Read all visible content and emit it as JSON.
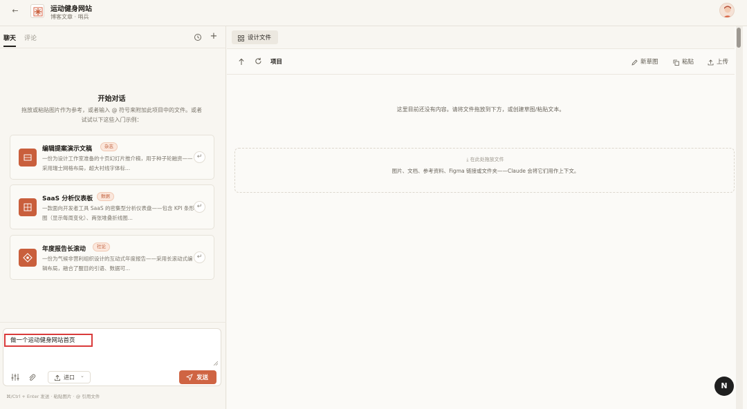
{
  "header": {
    "back_label": "←",
    "title": "运动健身网站",
    "subtitle": "博客文章 · 哨兵"
  },
  "left": {
    "tabs": [
      {
        "label": "聊天"
      },
      {
        "label": "评论"
      }
    ],
    "start": {
      "title": "开始对话",
      "description": "拖放或粘贴图片作为参考，或者输入 @ 符号来附加此项目中的文件。或者试试以下这些入门示例："
    },
    "cards": [
      {
        "title": "编辑提案演示文稿",
        "tag": "杂志",
        "desc": "一份为设计工作室准备的十页幻灯片推介稿，用于种子轮融资——采用瑞士网格布局，超大衬线字体标...",
        "enter": "↵"
      },
      {
        "title": "SaaS 分析仪表板",
        "tag": "数据",
        "desc": "一款面向开发者工具 SaaS 的密集型分析仪表盘——包含 KPI 条形图（显示每周变化）、两张堆叠折线图...",
        "enter": "↵"
      },
      {
        "title": "年度报告长滚动",
        "tag": "社论",
        "desc": "一份为气候非营利组织设计的互动式年度报告——采用长滚动式编辑布局，融合了醒目的引语、数据可...",
        "enter": "↵"
      }
    ],
    "composer": {
      "input_value": "做一个运动健身网站首页",
      "import_label": "进口",
      "import_chevron": "⌄",
      "send_label": "发送",
      "hint": "⌘/Ctrl + Enter 发送 · 粘贴图片 · @ 引用文件"
    }
  },
  "right": {
    "file_tab_label": "设计文件",
    "toolbar": {
      "project_label": "项目",
      "new_sketch_label": "新草图",
      "paste_label": "粘贴",
      "upload_label": "上传"
    },
    "empty_message": "这里目前还没有内容。请将文件拖放到下方，或创建草图/粘贴文本。",
    "dropzone": {
      "title": "⤓ 在此处拖放文件",
      "description": "图片、文档、参考资料、Figma 链接或文件夹——Claude 会将它们用作上下文。"
    },
    "help_label": "N"
  },
  "colors": {
    "accent": "#cf6443",
    "card_icon": "#c95f3c",
    "highlight_box": "#d93a3a"
  }
}
